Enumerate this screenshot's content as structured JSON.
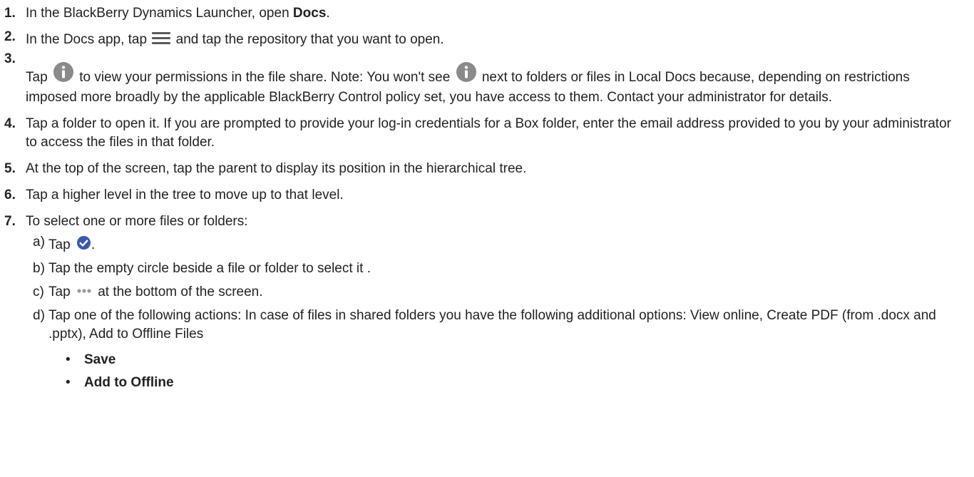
{
  "steps": [
    {
      "num": "1.",
      "pre": "In the BlackBerry Dynamics Launcher, open ",
      "bold": "Docs",
      "post": "."
    },
    {
      "num": "2.",
      "pre": "In the Docs app, tap ",
      "post": " and tap the repository that you want to open."
    },
    {
      "num": "3.",
      "pre": "Tap ",
      "mid": " to view your permissions in the file share. Note: You won't see ",
      "post": " next to folders or files in Local Docs because, depending on restrictions imposed more broadly by the applicable BlackBerry Control policy set, you have access to them. Contact your administrator for details."
    },
    {
      "num": "4.",
      "text": "Tap a folder to open it. If you are prompted to provide your log-in credentials for a Box folder, enter the email address provided to you by your administrator to access the files in that folder."
    },
    {
      "num": "5.",
      "text": "At the top of the screen, tap the parent to display its position in the hierarchical tree."
    },
    {
      "num": "6.",
      "text": "Tap a higher level in the tree to move up to that level."
    },
    {
      "num": "7.",
      "text": "To select one or more files or folders:"
    }
  ],
  "substeps": [
    {
      "letter": "a)",
      "pre": "Tap ",
      "post": "."
    },
    {
      "letter": "b)",
      "text": "Tap the empty circle beside a file or folder to select it ."
    },
    {
      "letter": "c)",
      "pre": "Tap ",
      "post": " at the bottom of the screen."
    },
    {
      "letter": "d)",
      "text": "Tap one of the following actions: In case of files in shared folders you have the following additional options: View online, Create PDF (from .docx and .pptx), Add to Offline Files"
    }
  ],
  "actions": [
    "Save",
    "Add to Offline"
  ],
  "bullet_char": "•",
  "colors": {
    "text": "#222222",
    "icon_gray": "#8a8a8a",
    "check_blue": "#3b5aa8",
    "dots": "#9a9a9a"
  },
  "icons": [
    "menu-icon",
    "info-icon",
    "checkmark-circle-icon",
    "more-dots-icon"
  ]
}
